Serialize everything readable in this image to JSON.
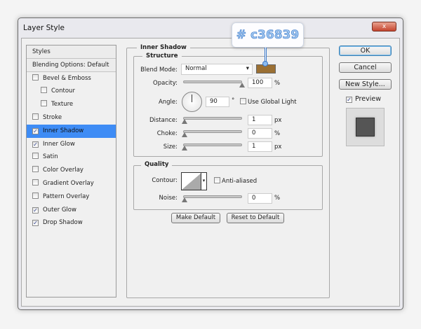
{
  "window": {
    "title": "Layer Style",
    "close_label": "x"
  },
  "sidebar": {
    "items": [
      {
        "label": "Styles",
        "type": "header"
      },
      {
        "label": "Blending Options: Default",
        "type": "header"
      },
      {
        "label": "Bevel & Emboss",
        "checked": false
      },
      {
        "label": "Contour",
        "checked": false,
        "indent": true
      },
      {
        "label": "Texture",
        "checked": false,
        "indent": true
      },
      {
        "label": "Stroke",
        "checked": false
      },
      {
        "label": "Inner Shadow",
        "checked": true,
        "selected": true
      },
      {
        "label": "Inner Glow",
        "checked": true
      },
      {
        "label": "Satin",
        "checked": false
      },
      {
        "label": "Color Overlay",
        "checked": false
      },
      {
        "label": "Gradient Overlay",
        "checked": false
      },
      {
        "label": "Pattern Overlay",
        "checked": false
      },
      {
        "label": "Outer Glow",
        "checked": true
      },
      {
        "label": "Drop Shadow",
        "checked": true
      }
    ],
    "selected_color": "#3e8cf5"
  },
  "panel": {
    "title": "Inner Shadow",
    "structure": {
      "title": "Structure",
      "blend_mode_label": "Blend Mode:",
      "blend_mode": "Normal",
      "color": "#c36839",
      "opacity_label": "Opacity:",
      "opacity": "100",
      "opacity_unit": "%",
      "angle_label": "Angle:",
      "angle": "90",
      "angle_unit": "°",
      "global_light_label": "Use Global Light",
      "global_light": false,
      "distance_label": "Distance:",
      "distance": "1",
      "distance_unit": "px",
      "choke_label": "Choke:",
      "choke": "0",
      "choke_unit": "%",
      "size_label": "Size:",
      "size": "1",
      "size_unit": "px"
    },
    "quality": {
      "title": "Quality",
      "contour_label": "Contour:",
      "anti_aliased_label": "Anti-aliased",
      "anti_aliased": false,
      "noise_label": "Noise:",
      "noise": "0",
      "noise_unit": "%"
    },
    "make_default": "Make Default",
    "reset_default": "Reset to Default"
  },
  "actions": {
    "ok": "OK",
    "cancel": "Cancel",
    "new_style": "New Style...",
    "preview_label": "Preview",
    "preview": true
  },
  "callout": {
    "text": "# c36839"
  }
}
